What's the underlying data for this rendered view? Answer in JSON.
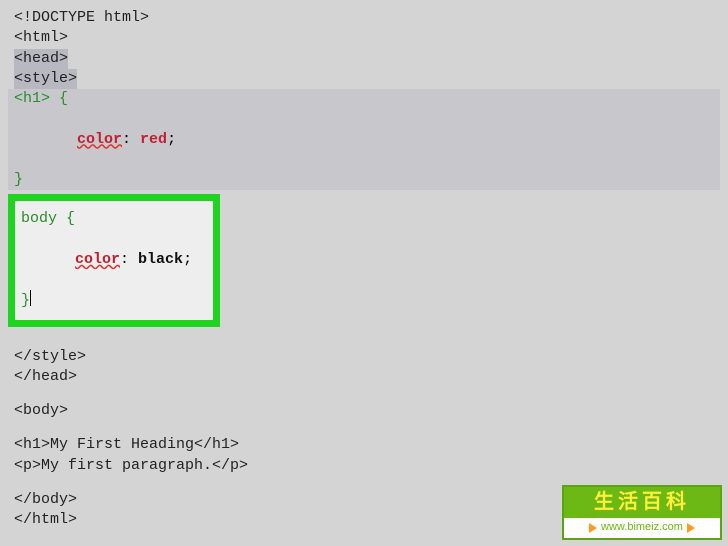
{
  "code": {
    "doctype": "<!DOCTYPE html>",
    "html_open": "<html>",
    "head_open": "<head>",
    "style_open": "<style>",
    "rule1_selector": "<h1>",
    "rule1_open": " {",
    "rule1_prop": "color",
    "rule1_colon": ": ",
    "rule1_value": "red",
    "rule1_semi": ";",
    "rule1_close": "}",
    "rule2_selector": "body",
    "rule2_open": " {",
    "rule2_prop": "color",
    "rule2_colon": ": ",
    "rule2_value": "black",
    "rule2_semi": ";",
    "rule2_close": "}",
    "style_close": "</style>",
    "head_close": "</head>",
    "body_open": "<body>",
    "h1_line": "<h1>My First Heading</h1>",
    "p_line": "<p>My first paragraph.</p>",
    "body_close": "</body>",
    "html_close": "</html>"
  },
  "watermark": {
    "title": "生活百科",
    "url": "www.bimeiz.com"
  }
}
